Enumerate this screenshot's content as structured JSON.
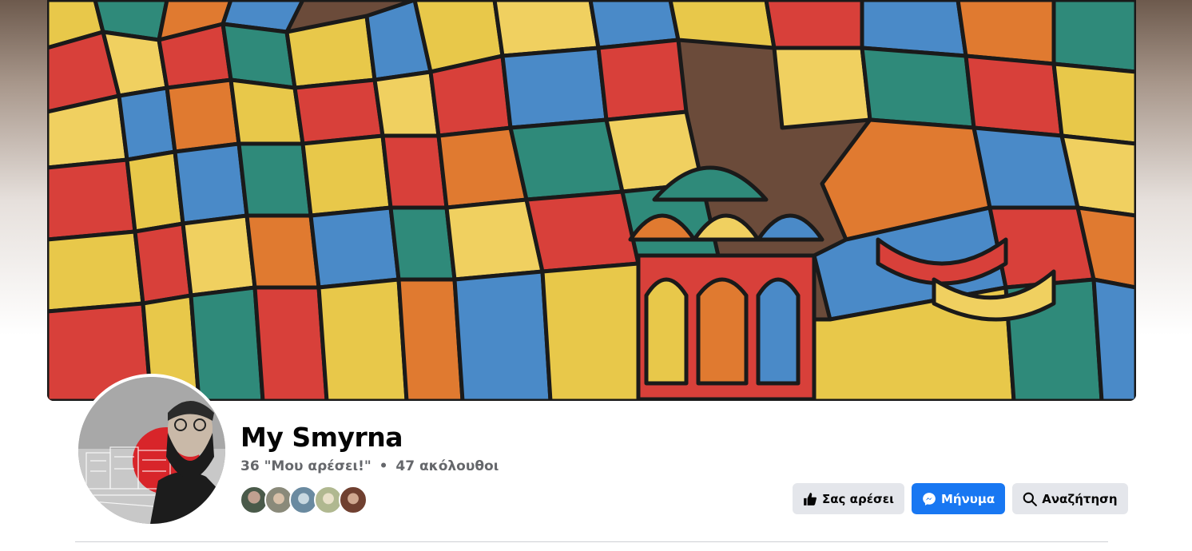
{
  "page": {
    "name": "My Smyrna",
    "likes": "36 \"Μου αρέσει!\"",
    "separator": "•",
    "followers": "47 ακόλουθοι"
  },
  "actions": {
    "like_label": "Σας αρέσει",
    "message_label": "Μήνυμα",
    "search_label": "Αναζήτηση"
  },
  "friends": [
    {
      "icon": "friend-avatar-1",
      "color": "#4a5a4a"
    },
    {
      "icon": "friend-avatar-2",
      "color": "#8a8a7a"
    },
    {
      "icon": "friend-avatar-3",
      "color": "#6a8aa0"
    },
    {
      "icon": "friend-avatar-4",
      "color": "#b0b890"
    },
    {
      "icon": "friend-avatar-5",
      "color": "#704030"
    }
  ],
  "colors": {
    "accent": "#1877f2",
    "button_grey": "#e4e6eb",
    "secondary_text": "#65676b"
  }
}
